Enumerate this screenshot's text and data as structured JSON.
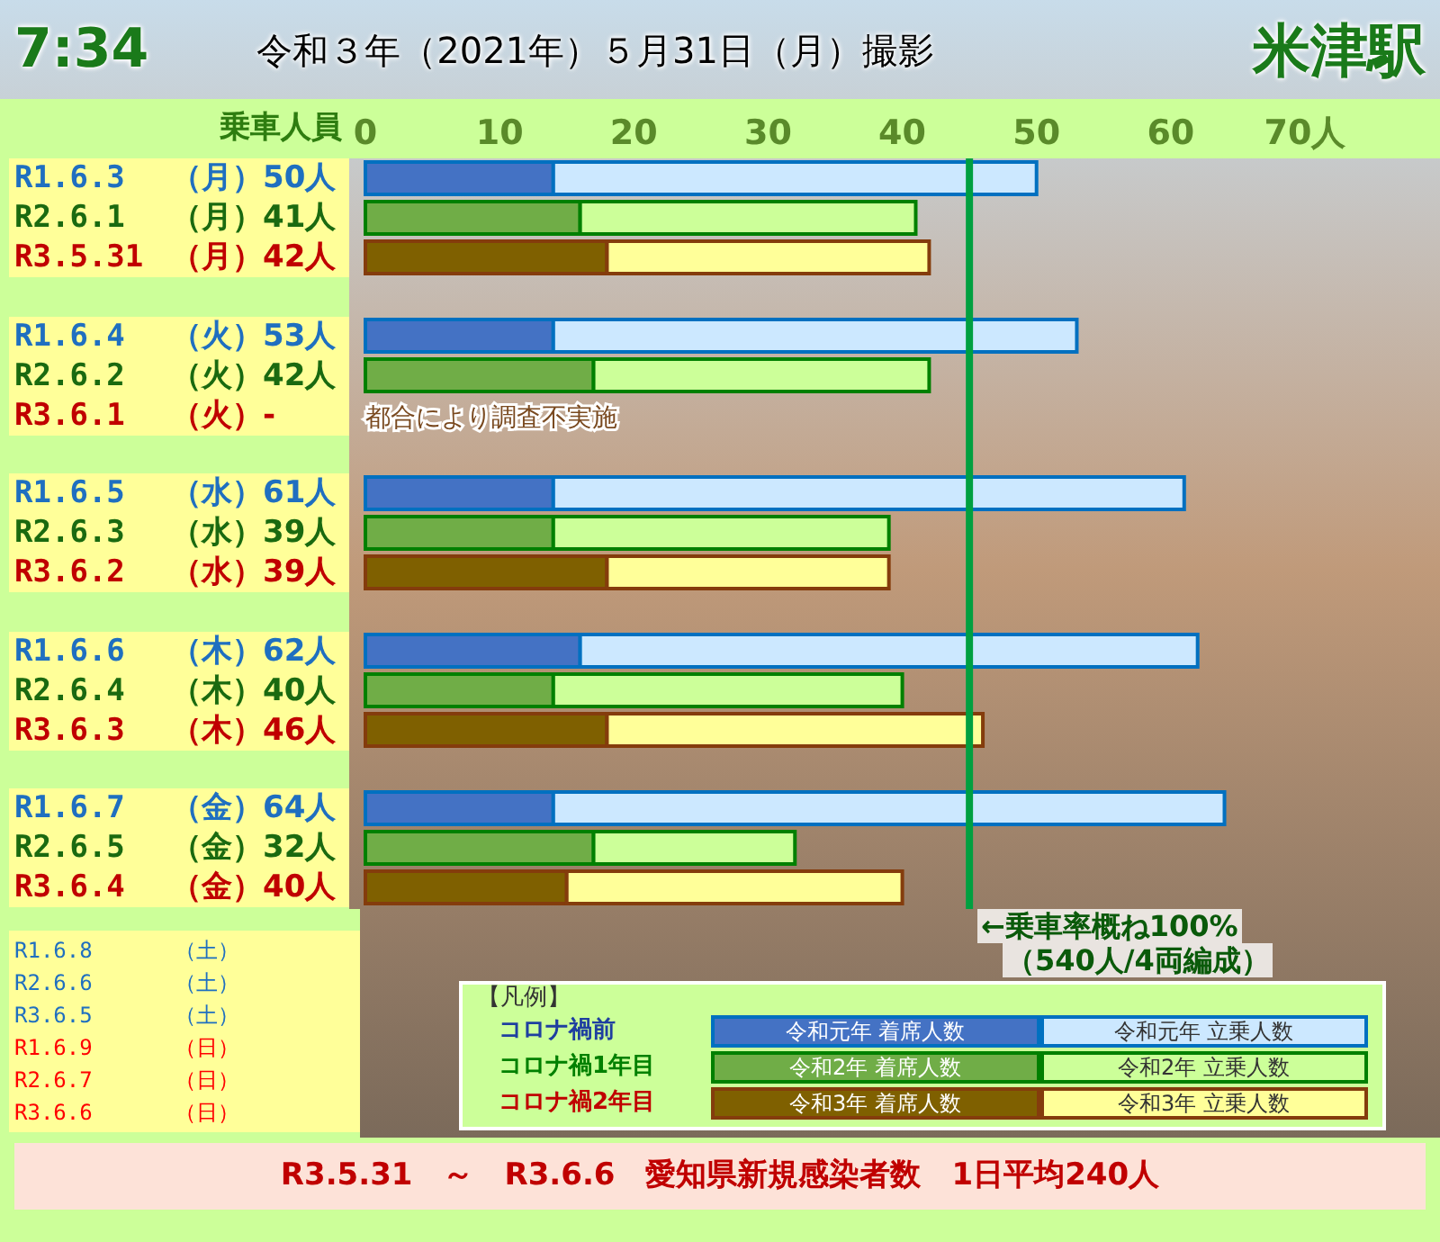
{
  "header": {
    "time": "7:34",
    "title": "令和３年（2021年）５月31日（月）撮影",
    "station": "米津駅"
  },
  "chart": {
    "groups": [
      {
        "rows": [
          {
            "day": "（月）",
            "count": "50人",
            "color": "#1f6fc0"
          },
          {
            "day": "（月）",
            "count": "41人",
            "color": "#1a6a10"
          },
          {
            "day": "（月）",
            "count": "42人",
            "color": "#c00000"
          }
        ]
      },
      {
        "rows": [
          {
            "day": "（火）",
            "count": "53人",
            "color": "#1f6fc0"
          },
          {
            "day": "（火）",
            "count": "42人",
            "color": "#1a6a10"
          },
          {
            "day": "（火）",
            "count": "-",
            "color": "#c00000",
            "note": "都合により調査不実施"
          }
        ]
      },
      {
        "rows": [
          {
            "day": "（水）",
            "count": "61人",
            "color": "#1f6fc0"
          },
          {
            "day": "（水）",
            "count": "39人",
            "color": "#1a6a10"
          },
          {
            "day": "（水）",
            "count": "39人",
            "color": "#c00000"
          }
        ]
      },
      {
        "rows": [
          {
            "day": "（木）",
            "count": "62人",
            "color": "#1f6fc0"
          },
          {
            "day": "（木）",
            "count": "40人",
            "color": "#1a6a10"
          },
          {
            "day": "（木）",
            "count": "46人",
            "color": "#c00000"
          }
        ]
      },
      {
        "rows": [
          {
            "day": "（金）",
            "count": "64人",
            "color": "#1f6fc0"
          },
          {
            "day": "（金）",
            "count": "32人",
            "color": "#1a6a10"
          },
          {
            "day": "（金）",
            "count": "40人",
            "color": "#c00000"
          }
        ]
      }
    ],
    "capacity_note": [
      "←乗車率概ね100%",
      "（540人/4両編成）"
    ],
    "chart_data": {
      "type": "bar",
      "orientation": "horizontal",
      "stacked": true,
      "xlabel": "乗車人員",
      "categories": [
        "R1.6.3",
        "R2.6.1",
        "R3.5.31",
        "R1.6.4",
        "R2.6.2",
        "R3.6.1",
        "R1.6.5",
        "R2.6.3",
        "R3.6.2",
        "R1.6.6",
        "R2.6.4",
        "R3.6.3",
        "R1.6.7",
        "R2.6.5",
        "R3.6.4"
      ],
      "series": [
        {
          "name": "令和元年 着席人数",
          "color": "#4472c4",
          "values": [
            14,
            null,
            null,
            14,
            null,
            null,
            14,
            null,
            null,
            16,
            null,
            null,
            14,
            null,
            null
          ]
        },
        {
          "name": "令和元年 立乗人数",
          "color": "#cce8ff",
          "values": [
            36,
            null,
            null,
            39,
            null,
            null,
            47,
            null,
            null,
            46,
            null,
            null,
            50,
            null,
            null
          ]
        },
        {
          "name": "令和2年 着席人数",
          "color": "#70ad47",
          "values": [
            null,
            16,
            null,
            null,
            17,
            null,
            null,
            14,
            null,
            null,
            14,
            null,
            null,
            17,
            null
          ]
        },
        {
          "name": "令和2年 立乗人数",
          "color": "#ccff99",
          "values": [
            null,
            25,
            null,
            null,
            25,
            null,
            null,
            25,
            null,
            null,
            26,
            null,
            null,
            15,
            null
          ]
        },
        {
          "name": "令和3年 着席人数",
          "color": "#7f6000",
          "values": [
            null,
            null,
            18,
            null,
            null,
            null,
            null,
            null,
            18,
            null,
            null,
            18,
            null,
            null,
            15
          ]
        },
        {
          "name": "令和3年 立乗人数",
          "color": "#ffff99",
          "values": [
            null,
            null,
            24,
            null,
            null,
            null,
            null,
            null,
            21,
            null,
            null,
            28,
            null,
            null,
            25
          ]
        }
      ],
      "ref_lines": [
        {
          "axis": "x",
          "value": 45,
          "color": "#00a040"
        }
      ],
      "xlim": [
        0,
        70
      ],
      "xticks": [
        0,
        10,
        20,
        30,
        40,
        50,
        60,
        {
          "value": 70,
          "label": "70人"
        }
      ]
    }
  },
  "weekend_rows": [
    {
      "date": "R1.6.8",
      "day": "（土）",
      "color": "#1f6fc0"
    },
    {
      "date": "R2.6.6",
      "day": "（土）",
      "color": "#1f6fc0"
    },
    {
      "date": "R3.6.5",
      "day": "（土）",
      "color": "#1f6fc0"
    },
    {
      "date": "R1.6.9",
      "day": "（日）",
      "color": "#ff0000"
    },
    {
      "date": "R2.6.7",
      "day": "（日）",
      "color": "#ff0000"
    },
    {
      "date": "R3.6.6",
      "day": "（日）",
      "color": "#ff0000"
    }
  ],
  "legend": {
    "title": "【凡例】",
    "items": [
      {
        "label": "コロナ禍前",
        "color": "#1f3fa0"
      },
      {
        "label": "コロナ禍1年目",
        "color": "#008000"
      },
      {
        "label": "コロナ禍2年目",
        "color": "#c00000"
      }
    ]
  },
  "footer": "R3.5.31　～　R3.6.6　愛知県新規感染者数　1日平均240人"
}
